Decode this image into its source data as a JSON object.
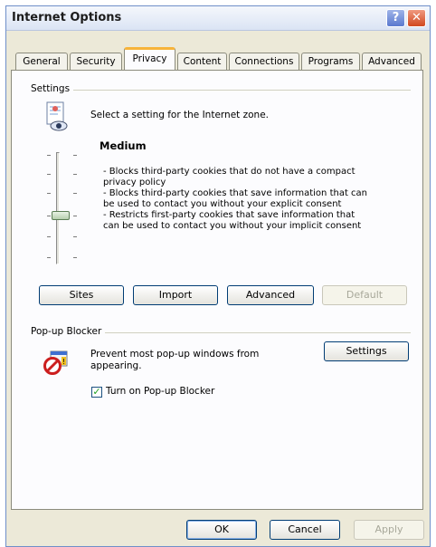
{
  "window": {
    "title": "Internet Options",
    "help_glyph": "?",
    "close_glyph": "✕"
  },
  "tabs": [
    {
      "label": "General"
    },
    {
      "label": "Security"
    },
    {
      "label": "Privacy",
      "active": true
    },
    {
      "label": "Content"
    },
    {
      "label": "Connections"
    },
    {
      "label": "Programs"
    },
    {
      "label": "Advanced"
    }
  ],
  "settings": {
    "group_label": "Settings",
    "zone_text": "Select a setting for the Internet zone.",
    "zone_icon": "privacy-page-icon",
    "level": "Medium",
    "slider_level": "Medium",
    "description": [
      "- Blocks third-party cookies that do not have a compact",
      "privacy policy",
      "- Blocks third-party cookies that save information that can",
      "be used to contact you without your explicit consent",
      "- Restricts first-party cookies that save information that",
      "can be used to contact you without your implicit consent"
    ],
    "buttons": {
      "sites": "Sites",
      "import": "Import",
      "advanced": "Advanced",
      "default": "Default"
    }
  },
  "popup": {
    "group_label": "Pop-up Blocker",
    "icon": "popup-blocked-icon",
    "text_line1": "Prevent most pop-up windows from",
    "text_line2": "appearing.",
    "settings_button": "Settings",
    "checkbox_label": "Turn on Pop-up Blocker",
    "checkbox_checked": true,
    "checkbox_mark": "✓"
  },
  "footer": {
    "ok": "OK",
    "cancel": "Cancel",
    "apply": "Apply"
  },
  "colors": {
    "dialog_bg": "#ece9d8",
    "panel_bg": "#fcfcfe",
    "active_tab_accent": "#f7b43a",
    "button_border": "#003c74",
    "close_button": "#d1481f"
  }
}
